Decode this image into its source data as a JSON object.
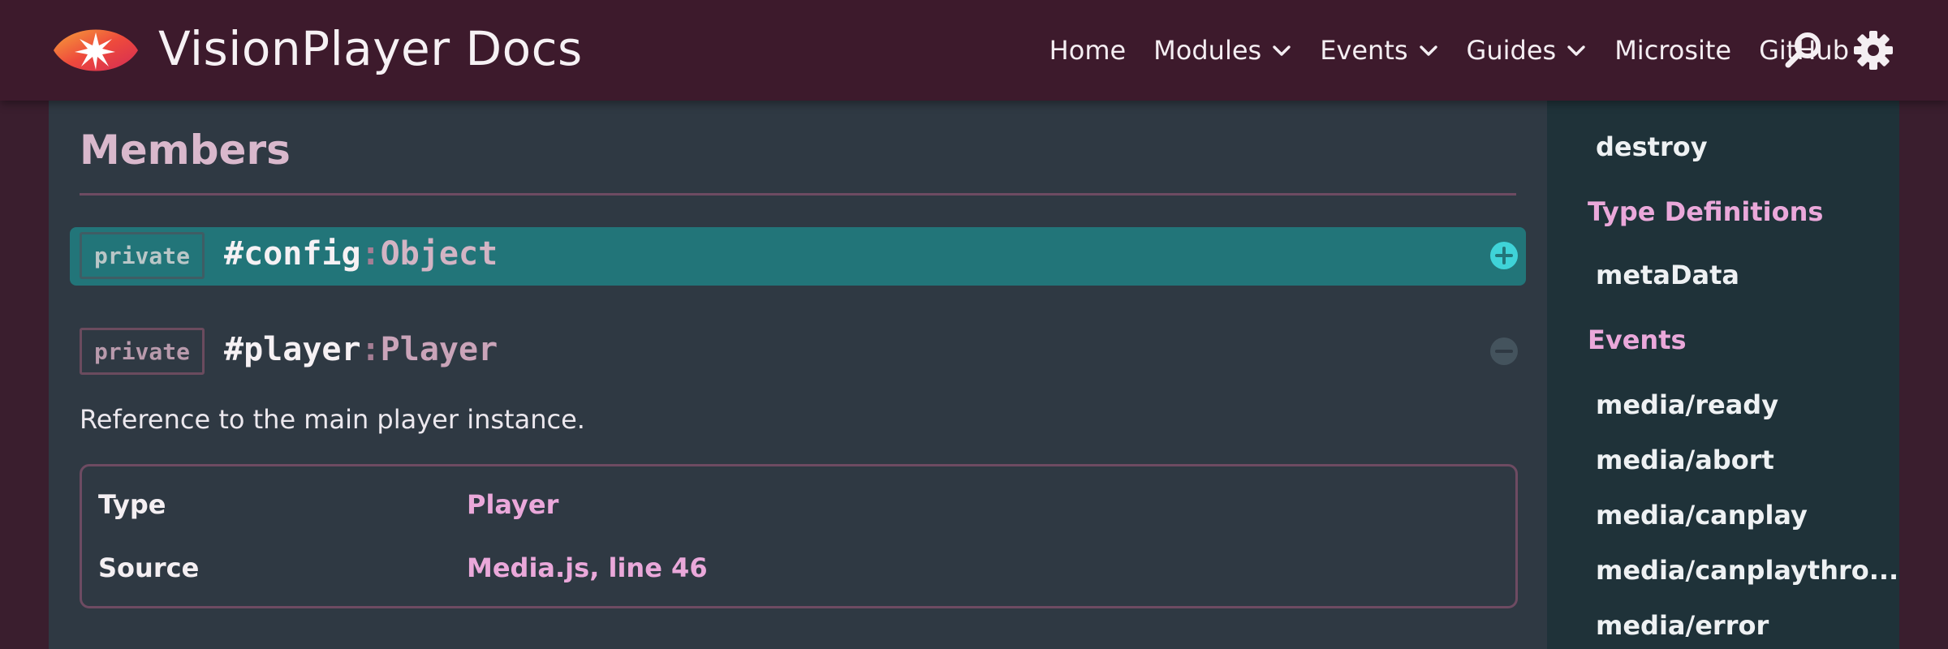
{
  "header": {
    "title": "VisionPlayer Docs",
    "nav": [
      {
        "label": "Home",
        "dropdown": false
      },
      {
        "label": "Modules",
        "dropdown": true
      },
      {
        "label": "Events",
        "dropdown": true
      },
      {
        "label": "Guides",
        "dropdown": true
      },
      {
        "label": "Microsite",
        "dropdown": false
      },
      {
        "label": "GitHub",
        "dropdown": false
      }
    ],
    "icons": {
      "logo": "vision-eye-logo",
      "search": "search-icon",
      "settings": "gear-icon"
    }
  },
  "main": {
    "section_title": "Members",
    "members": [
      {
        "badge": "private",
        "name": "#config",
        "separator": ":",
        "type": "Object",
        "expanded": false,
        "toggle_icon": "plus-circle-icon"
      },
      {
        "badge": "private",
        "name": "#player",
        "separator": ":",
        "type": "Player",
        "expanded": true,
        "toggle_icon": "minus-circle-icon"
      }
    ],
    "description": "Reference to the main player instance.",
    "properties": [
      {
        "label": "Type",
        "value": "Player"
      },
      {
        "label": "Source",
        "value": "Media.js, line 46"
      }
    ]
  },
  "sidebar": {
    "methods": [
      "destroy"
    ],
    "type_definitions_heading": "Type Definitions",
    "type_definitions": [
      "metaData"
    ],
    "events_heading": "Events",
    "events": [
      "media/ready",
      "media/abort",
      "media/canplay",
      "media/canplaythro...",
      "media/error"
    ]
  },
  "colors": {
    "header_bg": "#3d1a2c",
    "main_bg": "#2f3943",
    "sidebar_bg": "#1f3239",
    "active_row": "#227579",
    "accent_pink": "#eaa8da",
    "title_pink": "#d9b8cc"
  }
}
